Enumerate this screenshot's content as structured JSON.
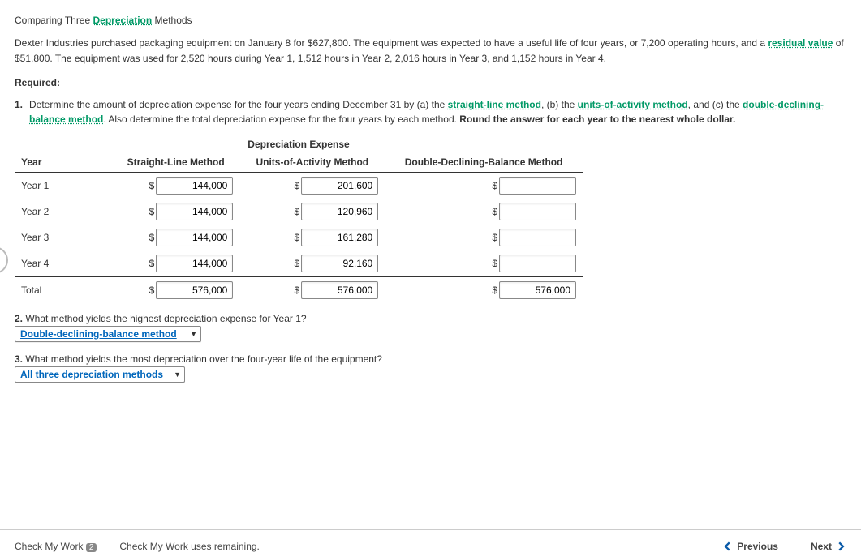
{
  "title_pre": "Comparing Three ",
  "title_link": "Depreciation",
  "title_post": " Methods",
  "intro1_pre": "Dexter Industries purchased packaging equipment on January 8 for $627,800. The equipment was expected to have a useful life of four years, or 7,200 operating hours, and a ",
  "intro1_link": "residual value",
  "intro1_post": " of $51,800. The equipment was used for 2,520 hours during Year 1, 1,512 hours in Year 2, 2,016 hours in Year 3, and 1,152 hours in Year 4.",
  "required_label": "Required:",
  "q1_num": "1.",
  "q1_a": "Determine the amount of depreciation expense for the four years ending December 31 by (a) the ",
  "q1_sl": "straight-line method",
  "q1_b": ", (b) the ",
  "q1_ua": "units-of-activity method",
  "q1_c": ", and (c) the ",
  "q1_ddb": "double-declining-balance method",
  "q1_d": ". Also determine the total depreciation expense for the four years by each method. ",
  "q1_bold": "Round the answer for each year to the nearest whole dollar.",
  "table_title": "Depreciation Expense",
  "headers": {
    "year": "Year",
    "sl": "Straight-Line Method",
    "ua": "Units-of-Activity Method",
    "ddb": "Double-Declining-Balance Method"
  },
  "rows": [
    {
      "label": "Year 1",
      "sl": "144,000",
      "ua": "201,600",
      "ddb": ""
    },
    {
      "label": "Year 2",
      "sl": "144,000",
      "ua": "120,960",
      "ddb": ""
    },
    {
      "label": "Year 3",
      "sl": "144,000",
      "ua": "161,280",
      "ddb": ""
    },
    {
      "label": "Year 4",
      "sl": "144,000",
      "ua": "92,160",
      "ddb": ""
    }
  ],
  "total": {
    "label": "Total",
    "sl": "576,000",
    "ua": "576,000",
    "ddb": "576,000"
  },
  "q2_num": "2.",
  "q2_text": "What method yields the highest depreciation expense for Year 1?",
  "q2_selected": "Double-declining-balance method",
  "q3_num": "3.",
  "q3_text": "What method yields the most depreciation over the four-year life of the equipment?",
  "q3_selected": "All three depreciation methods",
  "dollar": "$",
  "caret": "▼",
  "footer": {
    "check": "Check My Work",
    "checkn": "2",
    "remaining": "Check My Work uses remaining.",
    "prev": "Previous",
    "next": "Next"
  }
}
